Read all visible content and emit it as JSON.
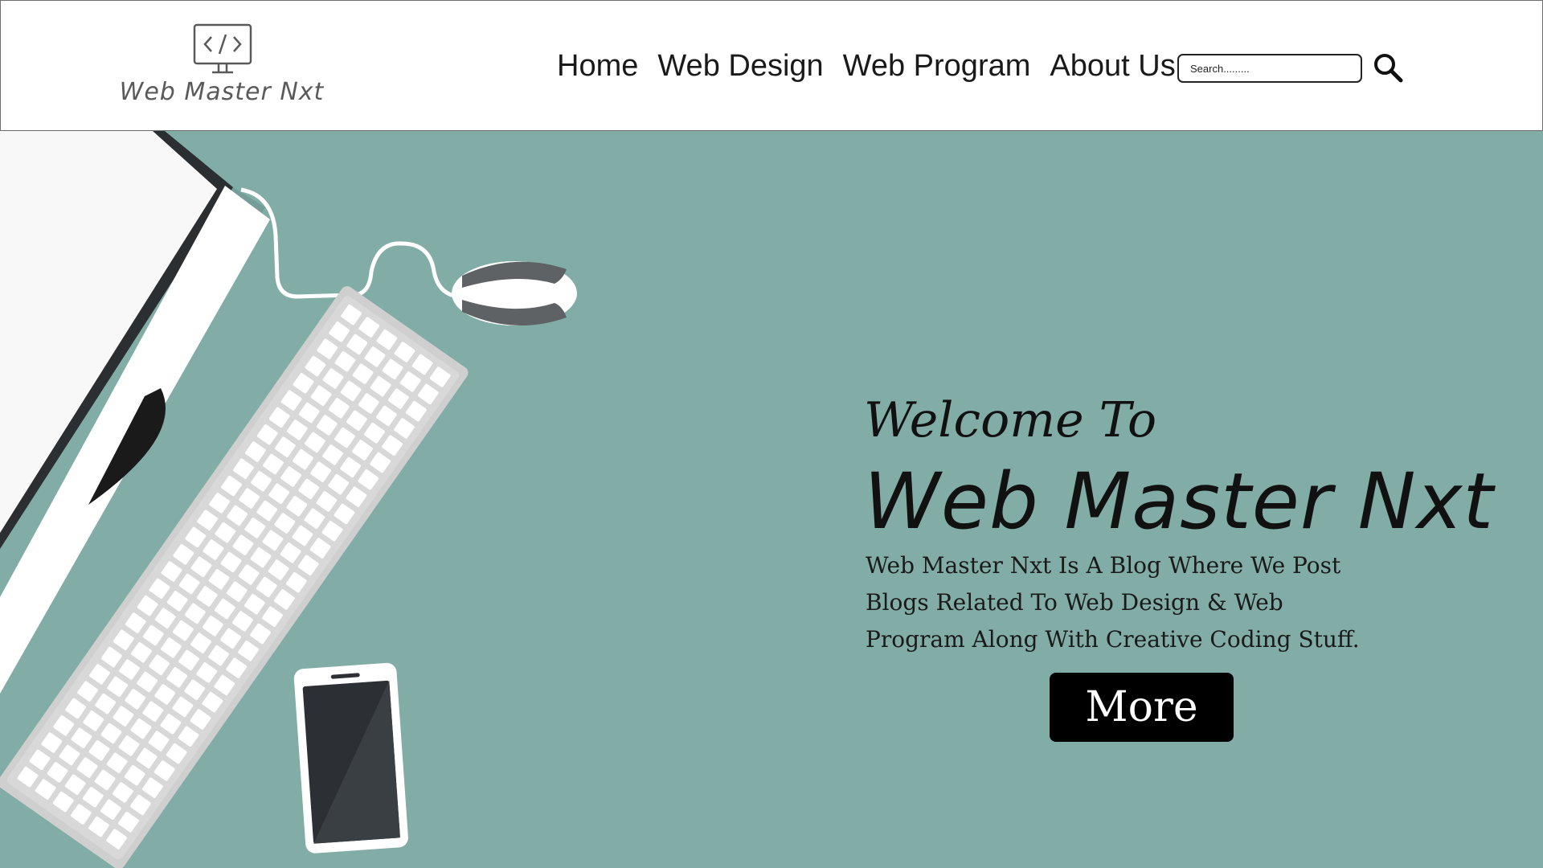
{
  "brand": {
    "name": "Web Master Nxt",
    "logo_icon": "code-monitor-icon"
  },
  "nav": {
    "items": [
      {
        "label": "Home"
      },
      {
        "label": "Web Design"
      },
      {
        "label": "Web Program"
      },
      {
        "label": "About Us"
      }
    ]
  },
  "search": {
    "placeholder": "Search.........",
    "icon": "search-icon"
  },
  "hero": {
    "welcome": "Welcome To",
    "title": "Web Master Nxt",
    "description": "Web Master Nxt Is A Blog Where We Post Blogs Related To Web Design & Web Program Along With Creative Coding Stuff.",
    "button_label": "More",
    "illustration_items": [
      "monitor",
      "keyboard",
      "mouse",
      "smartphone"
    ]
  },
  "colors": {
    "hero_background": "#82aca6",
    "header_background": "#ffffff",
    "button_background": "#000000",
    "text": "#111111"
  }
}
